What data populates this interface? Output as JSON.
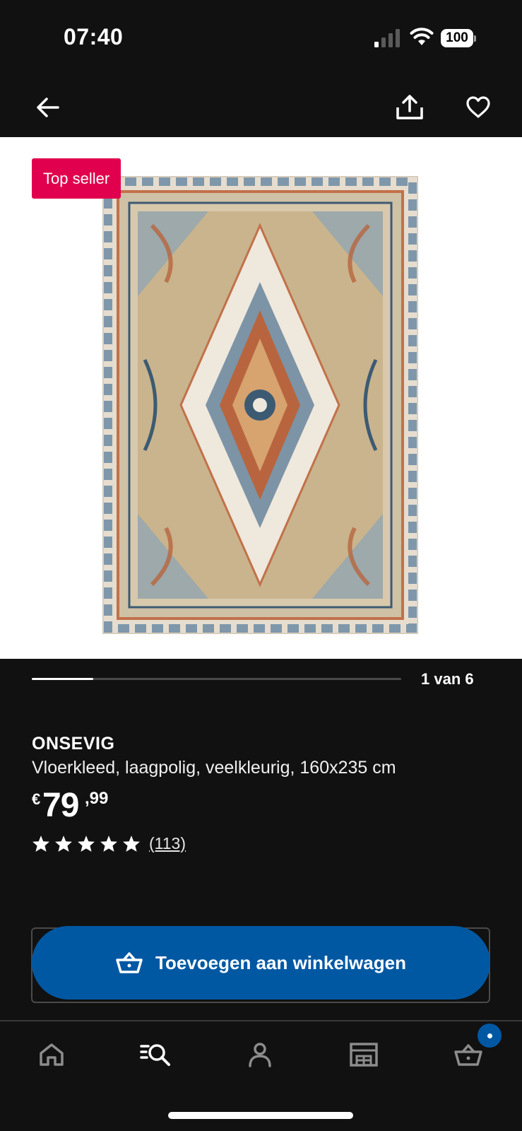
{
  "status_bar": {
    "time": "07:40",
    "battery": "100",
    "icons": [
      "signal-icon",
      "wifi-icon",
      "battery-icon"
    ]
  },
  "nav": {
    "icons": [
      "back-arrow-icon",
      "share-icon",
      "heart-icon"
    ]
  },
  "gallery": {
    "badge": "Top seller",
    "page_indicator": "1 van 6",
    "current_page": 1,
    "total_pages": 6
  },
  "product": {
    "name": "ONSEVIG",
    "description": "Vloerkleed, laagpolig, veelkleurig, 160x235 cm",
    "price_currency": "€",
    "price_main": "79",
    "price_cents": ",99",
    "rating_stars": 5,
    "review_count": "(113)"
  },
  "cart_button": {
    "label": "Toevoegen aan winkelwagen",
    "icon": "basket-icon"
  },
  "tab_bar": {
    "items": [
      "home-icon",
      "search-list-icon",
      "profile-icon",
      "store-icon",
      "basket-icon"
    ]
  },
  "colors": {
    "badge": "#e0004d",
    "primary": "#0058a3",
    "background": "#111111"
  }
}
